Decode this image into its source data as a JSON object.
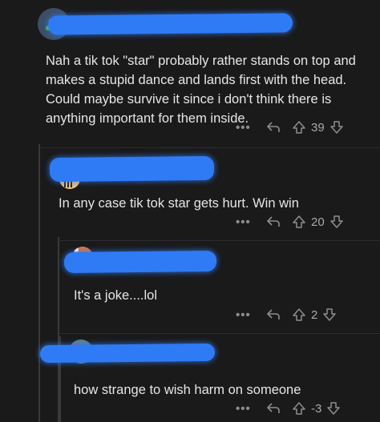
{
  "comments": [
    {
      "text": "Nah a tik tok \"star\" probably rather stands on top and makes a stupid dance and lands first with the head. Could maybe survive it since i don't think there is anything important for them inside.",
      "more": "•••",
      "score": "39"
    },
    {
      "text": "In any case tik tok star gets hurt. Win win",
      "more": "•••",
      "score": "20"
    },
    {
      "text": "It's a joke....lol",
      "more": "•••",
      "score": "2"
    },
    {
      "text": "how strange to wish harm on someone",
      "more": "•••",
      "score": "-3"
    }
  ],
  "colors": {
    "background": "#1a1a1b",
    "redaction": "#2f7bf5",
    "icon": "#8b8e90"
  }
}
